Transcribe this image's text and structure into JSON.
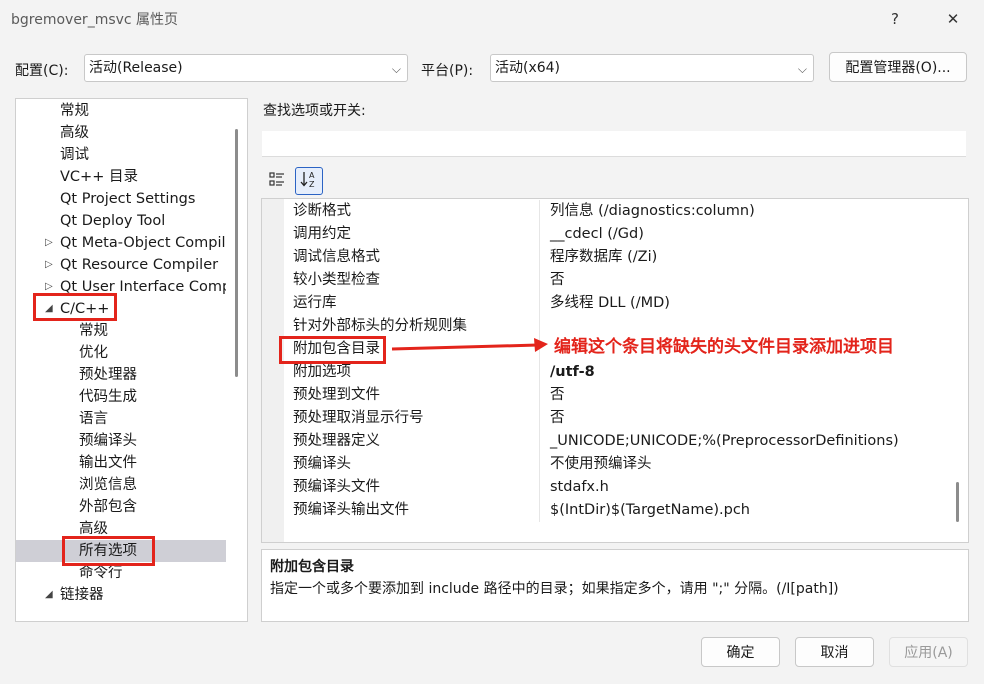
{
  "window": {
    "title": "bgremover_msvc 属性页",
    "help_glyph": "?",
    "close_glyph": "✕"
  },
  "config": {
    "label": "配置(C):",
    "value": "活动(Release)",
    "platform_label": "平台(P):",
    "platform_value": "活动(x64)",
    "manager_button": "配置管理器(O)..."
  },
  "tree": {
    "items": [
      {
        "label": "常规",
        "level": 1
      },
      {
        "label": "高级",
        "level": 1
      },
      {
        "label": "调试",
        "level": 1
      },
      {
        "label": "VC++ 目录",
        "level": 1
      },
      {
        "label": "Qt Project Settings",
        "level": 1
      },
      {
        "label": "Qt Deploy Tool",
        "level": 1
      },
      {
        "label": "Qt Meta-Object Compiler",
        "level": 1,
        "expander": "collapsed"
      },
      {
        "label": "Qt Resource Compiler",
        "level": 1,
        "expander": "collapsed"
      },
      {
        "label": "Qt User Interface Compiler",
        "level": 1,
        "expander": "collapsed"
      },
      {
        "label": "C/C++",
        "level": 1,
        "expander": "expanded"
      },
      {
        "label": "常规",
        "level": 2
      },
      {
        "label": "优化",
        "level": 2
      },
      {
        "label": "预处理器",
        "level": 2
      },
      {
        "label": "代码生成",
        "level": 2
      },
      {
        "label": "语言",
        "level": 2
      },
      {
        "label": "预编译头",
        "level": 2
      },
      {
        "label": "输出文件",
        "level": 2
      },
      {
        "label": "浏览信息",
        "level": 2
      },
      {
        "label": "外部包含",
        "level": 2
      },
      {
        "label": "高级",
        "level": 2
      },
      {
        "label": "所有选项",
        "level": 2,
        "selected": true
      },
      {
        "label": "命令行",
        "level": 2
      },
      {
        "label": "链接器",
        "level": 1,
        "expander": "expanded"
      }
    ]
  },
  "search": {
    "label": "查找选项或开关:",
    "value": ""
  },
  "toolbar": {
    "categorized_icon": "categorized-icon",
    "alphabetical_icon": "sort-az-icon"
  },
  "grid": {
    "rows": [
      {
        "key": "诊断格式",
        "value": "列信息 (/diagnostics:column)"
      },
      {
        "key": "调用约定",
        "value": "__cdecl (/Gd)"
      },
      {
        "key": "调试信息格式",
        "value": "程序数据库 (/Zi)"
      },
      {
        "key": "较小类型检查",
        "value": "否"
      },
      {
        "key": "运行库",
        "value": "多线程 DLL (/MD)"
      },
      {
        "key": "针对外部标头的分析规则集",
        "value": ""
      },
      {
        "key": "附加包含目录",
        "value": ""
      },
      {
        "key": "附加选项",
        "value": "/utf-8",
        "bold": true
      },
      {
        "key": "预处理到文件",
        "value": "否"
      },
      {
        "key": "预处理取消显示行号",
        "value": "否"
      },
      {
        "key": "预处理器定义",
        "value": "_UNICODE;UNICODE;%(PreprocessorDefinitions)"
      },
      {
        "key": "预编译头",
        "value": "不使用预编译头"
      },
      {
        "key": "预编译头文件",
        "value": "stdafx.h"
      },
      {
        "key": "预编译头输出文件",
        "value": "$(IntDir)$(TargetName).pch"
      }
    ]
  },
  "description": {
    "title": "附加包含目录",
    "text": "指定一个或多个要添加到 include 路径中的目录；如果指定多个，请用 \";\" 分隔。(/I[path])"
  },
  "annotation": {
    "text": "编辑这个条目将缺失的头文件目录添加进项目",
    "color": "#e3241b"
  },
  "buttons": {
    "ok": "确定",
    "cancel": "取消",
    "apply": "应用(A)"
  }
}
